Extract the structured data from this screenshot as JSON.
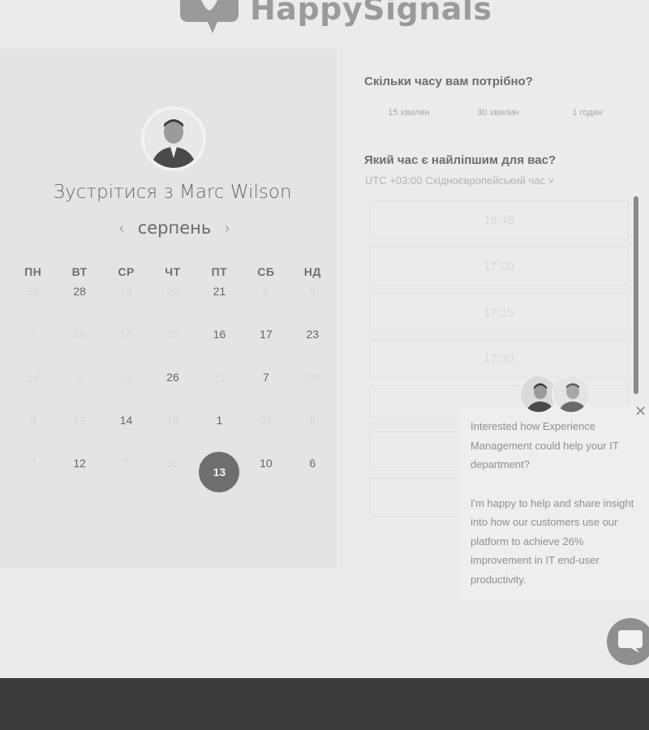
{
  "header": {
    "logo_text": "HappySignals"
  },
  "calendar": {
    "title": "Зустрітися з Marc Wilson",
    "month": "серпень",
    "weekdays": [
      "ПН",
      "ВТ",
      "СР",
      "ЧТ",
      "ПТ",
      "СБ",
      "НД"
    ],
    "weeks": [
      [
        {
          "d": "26",
          "s": "faded"
        },
        {
          "d": "28",
          "s": "avail"
        },
        {
          "d": "18",
          "s": "faded"
        },
        {
          "d": "26",
          "s": "faded"
        },
        {
          "d": "21",
          "s": "avail"
        },
        {
          "d": "2",
          "s": "faded"
        },
        {
          "d": "9",
          "s": "faded"
        }
      ],
      [
        {
          "d": "7",
          "s": "faded"
        },
        {
          "d": "28",
          "s": "faded"
        },
        {
          "d": "14",
          "s": "faded"
        },
        {
          "d": "25",
          "s": "faded"
        },
        {
          "d": "16",
          "s": "avail"
        },
        {
          "d": "17",
          "s": "avail"
        },
        {
          "d": "23",
          "s": "avail"
        }
      ],
      [
        {
          "d": "14",
          "s": "faded"
        },
        {
          "d": "9",
          "s": "faded"
        },
        {
          "d": "14",
          "s": "faded"
        },
        {
          "d": "26",
          "s": "avail"
        },
        {
          "d": "21",
          "s": "faded"
        },
        {
          "d": "7",
          "s": "avail"
        },
        {
          "d": "20",
          "s": "faded"
        }
      ],
      [
        {
          "d": "8",
          "s": "faded"
        },
        {
          "d": "19",
          "s": "faded"
        },
        {
          "d": "14",
          "s": "avail"
        },
        {
          "d": "18",
          "s": "faded"
        },
        {
          "d": "1",
          "s": "avail"
        },
        {
          "d": "23",
          "s": "faded"
        },
        {
          "d": "8",
          "s": "faded"
        }
      ],
      [
        {
          "d": "2",
          "s": "faded"
        },
        {
          "d": "12",
          "s": "avail"
        },
        {
          "d": "3",
          "s": "faded"
        },
        {
          "d": "30",
          "s": "faded"
        },
        {
          "d": "13",
          "s": "selected"
        },
        {
          "d": "10",
          "s": "avail"
        },
        {
          "d": "6",
          "s": "avail"
        }
      ]
    ]
  },
  "booking": {
    "duration_question": "Скільки часу вам потрібно?",
    "durations": [
      "15 хвилин",
      "30 хвилин",
      "1 годин"
    ],
    "time_question": "Який час є найліпшим для вас?",
    "timezone": "UTC +03:00 Східноєвропейський час ˅",
    "slots": [
      "16:45",
      "17:00",
      "17:15",
      "17:30",
      "",
      "",
      ""
    ]
  },
  "chat": {
    "message_1": "Interested how Experience Management could help your IT department?",
    "message_2": "I'm happy to help and share insight into how our customers use our platform to achieve 26% improvement in IT end-user productivity.",
    "close_glyph": "✕"
  }
}
